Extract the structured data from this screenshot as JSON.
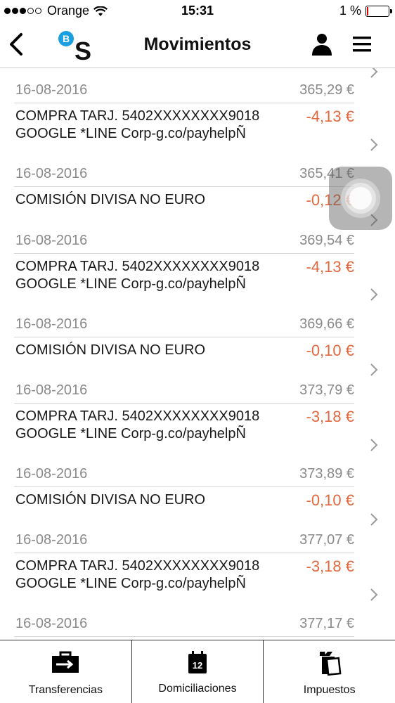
{
  "status": {
    "carrier": "Orange",
    "time": "15:31",
    "battery": "1 %"
  },
  "nav": {
    "title": "Movimientos",
    "logo_letters": "BS"
  },
  "transactions": [
    {
      "date": "16-08-2016",
      "balance": "365,29 €",
      "desc1": "COMPRA TARJ. 5402XXXXXXXX9018",
      "desc2": "GOOGLE *LINE Corp-g.co/payhelpÑ",
      "amount": "-4,13 €"
    },
    {
      "date": "16-08-2016",
      "balance": "365,41 €",
      "desc1": "COMISIÓN DIVISA NO EURO",
      "desc2": "",
      "amount": "-0,12 €"
    },
    {
      "date": "16-08-2016",
      "balance": "369,54 €",
      "desc1": "COMPRA TARJ. 5402XXXXXXXX9018",
      "desc2": "GOOGLE *LINE Corp-g.co/payhelpÑ",
      "amount": "-4,13 €"
    },
    {
      "date": "16-08-2016",
      "balance": "369,66 €",
      "desc1": "COMISIÓN DIVISA NO EURO",
      "desc2": "",
      "amount": "-0,10 €"
    },
    {
      "date": "16-08-2016",
      "balance": "373,79 €",
      "desc1": "COMPRA TARJ. 5402XXXXXXXX9018",
      "desc2": "GOOGLE *LINE Corp-g.co/payhelpÑ",
      "amount": "-3,18 €"
    },
    {
      "date": "16-08-2016",
      "balance": "373,89 €",
      "desc1": "COMISIÓN DIVISA NO EURO",
      "desc2": "",
      "amount": "-0,10 €"
    },
    {
      "date": "16-08-2016",
      "balance": "377,07 €",
      "desc1": "COMPRA TARJ. 5402XXXXXXXX9018",
      "desc2": "GOOGLE *LINE Corp-g.co/payhelpÑ",
      "amount": "-3,18 €"
    },
    {
      "date": "16-08-2016",
      "balance": "377,17 €"
    }
  ],
  "tabs": [
    {
      "label": "Transferencias",
      "icon": "briefcase-arrow-icon"
    },
    {
      "label": "Domiciliaciones",
      "icon": "calendar-icon",
      "icon_text": "12"
    },
    {
      "label": "Impuestos",
      "icon": "documents-icon"
    }
  ],
  "colors": {
    "amount": "#e2683f",
    "logo_blue": "#1a9fe0"
  }
}
